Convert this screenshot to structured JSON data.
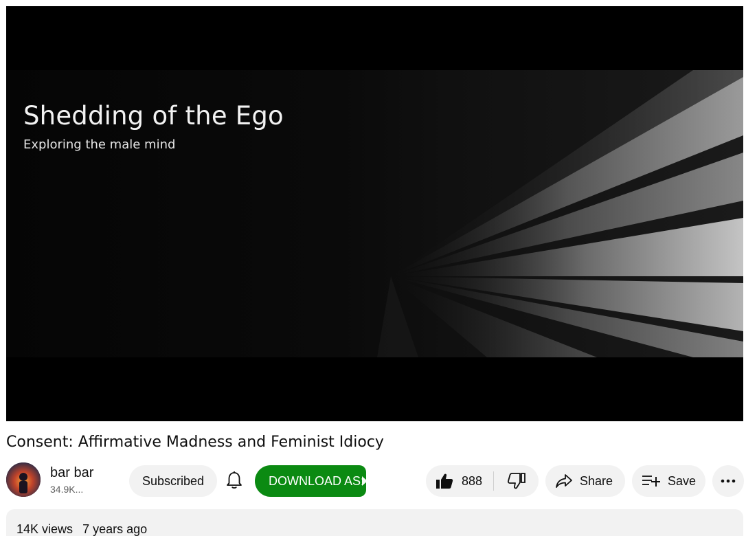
{
  "video": {
    "thumbnail_title": "Shedding of the Ego",
    "thumbnail_subtitle": "Exploring the male mind",
    "title": "Consent: Affirmative Madness and Feminist Idiocy"
  },
  "channel": {
    "name": "bar bar",
    "subscribers": "34.9K..."
  },
  "actions": {
    "subscribe_label": "Subscribed",
    "bell_icon": "bell-icon",
    "download_label": "DOWNLOAD AS:",
    "like_count": "888",
    "share_label": "Share",
    "save_label": "Save",
    "more_icon": "more-horizontal-icon"
  },
  "description": {
    "views": "14K views",
    "age": "7 years ago"
  },
  "colors": {
    "download_bg": "#0b8a12",
    "pill_bg": "#f2f2f2",
    "player_bg": "#000000"
  }
}
